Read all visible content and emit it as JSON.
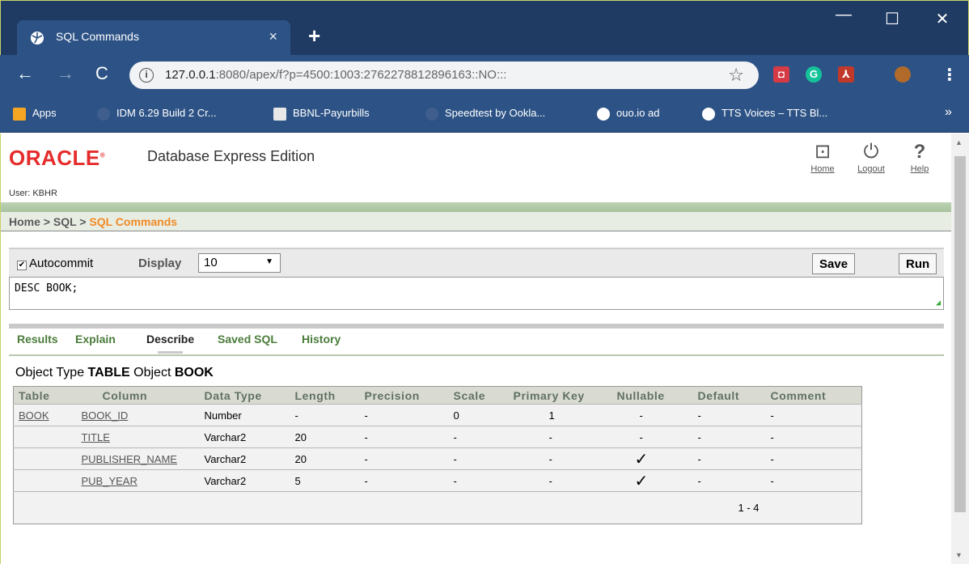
{
  "browser": {
    "tab_title": "SQL Commands",
    "tab_close": "×",
    "new_tab": "+",
    "window_controls": [
      "—",
      "☐",
      "✕"
    ],
    "url_host": "127.0.0.1",
    "url_rest": ":8080/apex/f?p=4500:1003:2762278812896163::NO:::",
    "bookmarks": [
      "Apps",
      "IDM 6.29 Build 2 Cr...",
      "BBNL-Payurbills",
      "Speedtest by Ookla...",
      "ouo.io ad",
      "TTS Voices – TTS Bl..."
    ],
    "bookmarks_more": "»",
    "extension_colors": [
      "#d63a45",
      "#15c39a",
      "#c0392b"
    ]
  },
  "header": {
    "logo": "ORACLE",
    "product": "Database Express Edition",
    "user_label": "User: KBHR",
    "links": [
      {
        "label": "Home",
        "icon": "home-icon"
      },
      {
        "label": "Logout",
        "icon": "power-icon"
      },
      {
        "label": "Help",
        "icon": "question-icon"
      }
    ]
  },
  "breadcrumb": {
    "home": "Home",
    "sep1": " > ",
    "sql": "SQL",
    "sep2": " > ",
    "current": "SQL Commands"
  },
  "command_bar": {
    "autocommit_label": "Autocommit",
    "display_label": "Display",
    "display_value": "10",
    "save_label": "Save",
    "run_label": "Run"
  },
  "editor": {
    "sql": "DESC BOOK;"
  },
  "result_tabs": [
    "Results",
    "Explain",
    "Describe",
    "Saved SQL",
    "History"
  ],
  "active_tab": "Describe",
  "object_info": {
    "type_label": "Object Type",
    "type_value": "TABLE",
    "object_label": "Object",
    "object_value": "BOOK"
  },
  "describe_table": {
    "columns": [
      "Table",
      "Column",
      "Data Type",
      "Length",
      "Precision",
      "Scale",
      "Primary Key",
      "Nullable",
      "Default",
      "Comment"
    ],
    "rows": [
      [
        "BOOK",
        "BOOK_ID",
        "Number",
        "-",
        "-",
        "0",
        "1",
        "-",
        "-",
        "-"
      ],
      [
        "",
        "TITLE",
        "Varchar2",
        "20",
        "-",
        "-",
        "-",
        "-",
        "-",
        "-"
      ],
      [
        "",
        "PUBLISHER_NAME",
        "Varchar2",
        "20",
        "-",
        "-",
        "-",
        "✓",
        "-",
        "-"
      ],
      [
        "",
        "PUB_YEAR",
        "Varchar2",
        "5",
        "-",
        "-",
        "-",
        "✓",
        "-",
        "-"
      ]
    ],
    "pagination": "1 - 4"
  },
  "colors": {
    "accent_green": "#4a7c3a",
    "breadcrumb_current": "#f08a24",
    "oracle_red": "#e52b2b"
  }
}
